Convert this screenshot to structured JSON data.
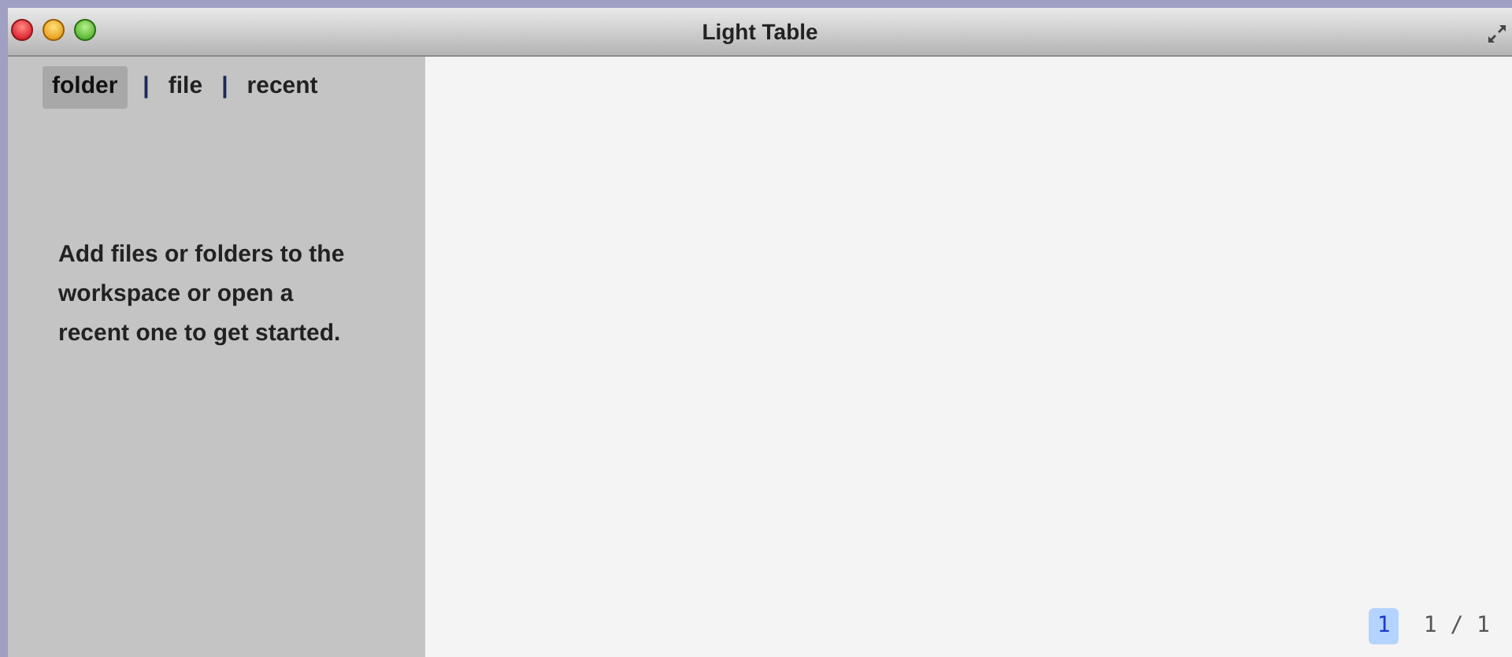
{
  "window": {
    "title": "Light Table"
  },
  "sidebar": {
    "tabs": [
      {
        "label": "folder",
        "selected": true
      },
      {
        "label": "file",
        "selected": false
      },
      {
        "label": "recent",
        "selected": false
      }
    ],
    "tab_separators": [
      "|",
      "|"
    ],
    "message": "Add files or folders to the workspace or open a recent one to get started."
  },
  "status_bar": {
    "current": "1",
    "position": "1 / 1"
  }
}
